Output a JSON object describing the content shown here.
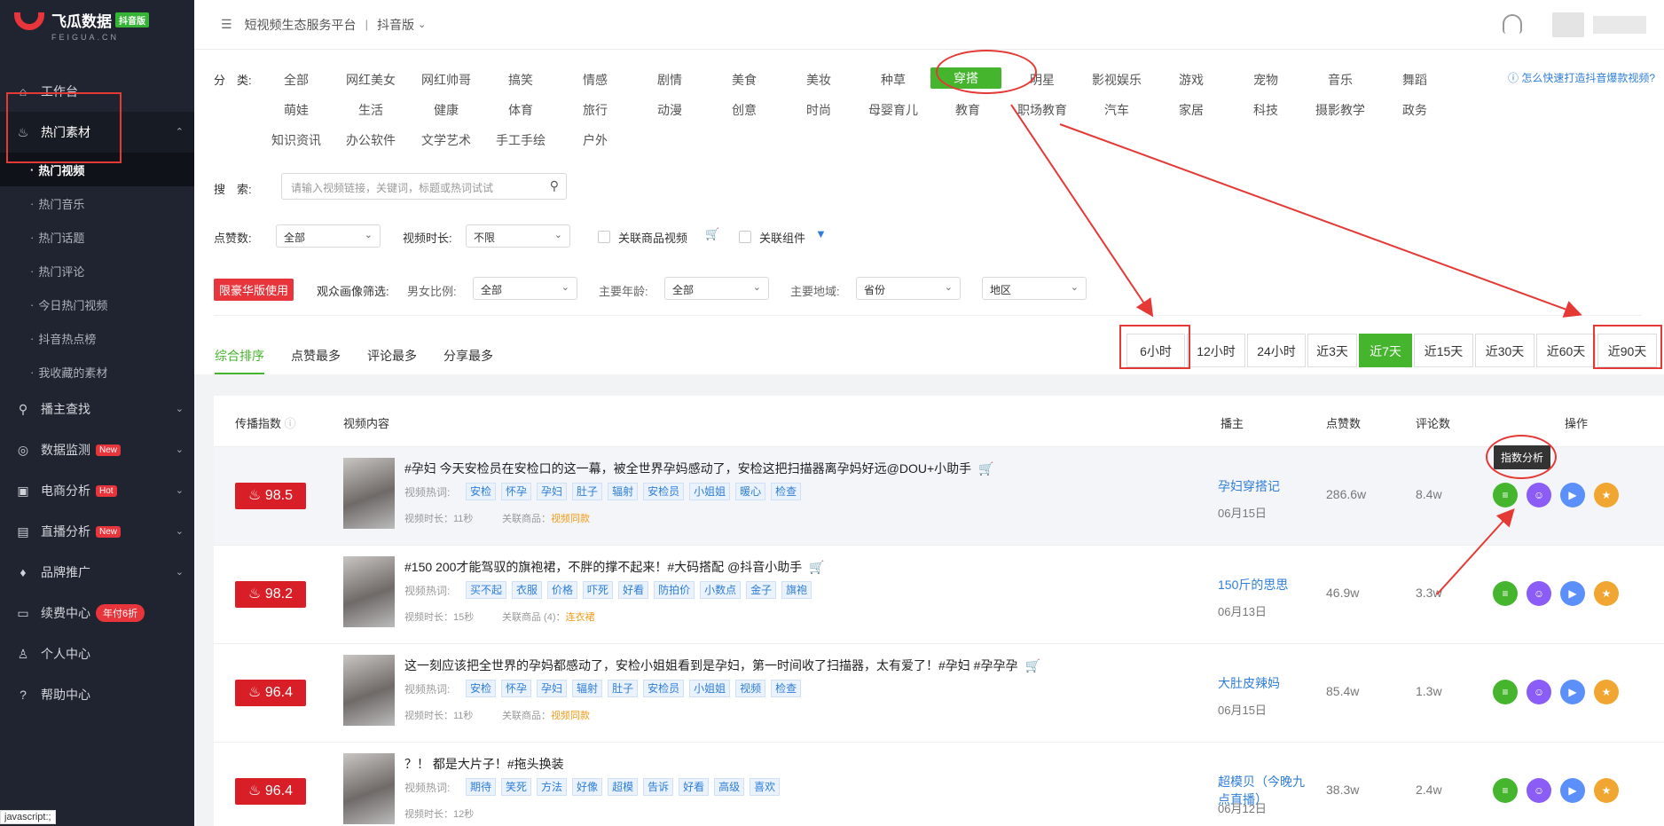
{
  "sidebar": {
    "logo_title": "飞瓜数据",
    "logo_badge": "抖音版",
    "logo_sub": "FEIGUA.CN",
    "workbench": "工作台",
    "hot_material": "热门素材",
    "sub_items": [
      "热门视频",
      "热门音乐",
      "热门话题",
      "热门评论",
      "今日热门视频",
      "抖音热点榜",
      "我收藏的素材"
    ],
    "streamer_search": "播主查找",
    "data_monitor": "数据监测",
    "data_monitor_badge": "New",
    "ecom": "电商分析",
    "ecom_badge": "Hot",
    "live": "直播分析",
    "live_badge": "New",
    "brand": "品牌推广",
    "renew": "续费中心",
    "renew_badge": "年付6折",
    "personal": "个人中心",
    "help": "帮助中心"
  },
  "topbar": {
    "title": "短视频生态服务平台",
    "sep": "|",
    "version": "抖音版"
  },
  "filters": {
    "category_label": "分　类:",
    "categories_row1": [
      "全部",
      "网红美女",
      "网红帅哥",
      "搞笑",
      "情感",
      "剧情",
      "美食",
      "美妆",
      "种草",
      "穿搭",
      "明星",
      "影视娱乐",
      "游戏",
      "宠物",
      "音乐",
      "舞蹈"
    ],
    "categories_row2": [
      "萌娃",
      "生活",
      "健康",
      "体育",
      "旅行",
      "动漫",
      "创意",
      "时尚",
      "母婴育儿",
      "教育",
      "职场教育",
      "汽车",
      "家居",
      "科技",
      "摄影教学",
      "政务"
    ],
    "categories_row3": [
      "知识资讯",
      "办公软件",
      "文学艺术",
      "手工手绘",
      "户外"
    ],
    "help_link": "怎么快速打造抖音爆款视频?",
    "search_label": "搜　索:",
    "search_placeholder": "请输入视频链接，关键词，标题或热词试试",
    "likes_label": "点赞数:",
    "likes_value": "全部",
    "duration_label": "视频时长:",
    "duration_value": "不限",
    "goods_check": "关联商品视频",
    "component_check": "关联组件",
    "lux_badge": "限豪华版使用",
    "audience_label": "观众画像筛选:",
    "gender_label": "男女比例:",
    "gender_value": "全部",
    "age_label": "主要年龄:",
    "age_value": "全部",
    "region_label": "主要地域:",
    "province_value": "省份",
    "area_value": "地区"
  },
  "sort_tabs": [
    "综合排序",
    "点赞最多",
    "评论最多",
    "分享最多"
  ],
  "time_ranges": [
    "6小时",
    "12小时",
    "24小时",
    "近3天",
    "近7天",
    "近15天",
    "近30天",
    "近60天",
    "近90天"
  ],
  "table": {
    "headers": [
      "传播指数",
      "视频内容",
      "播主",
      "点赞数",
      "评论数",
      "操作"
    ],
    "hot_label": "视频热词:",
    "tooltip": "指数分析",
    "rows": [
      {
        "score": "98.5",
        "title": "#孕妇 今天安检员在安检口的这一幕，被全世界孕妈感动了，安检这把扫描器离孕妈好远@DOU+小助手",
        "tags": [
          "安检",
          "怀孕",
          "孕妇",
          "肚子",
          "辐射",
          "安检员",
          "小姐姐",
          "暖心",
          "检查"
        ],
        "duration": "视频时长：11秒",
        "goods_label": "关联商品：",
        "goods_value": "视频同款",
        "author": "孕妇穿搭记",
        "date": "06月15日",
        "likes": "286.6w",
        "comments": "8.4w"
      },
      {
        "score": "98.2",
        "title": "#150 200才能驾驭的旗袍裙，不胖的撑不起来！#大码搭配 @抖音小助手",
        "tags": [
          "买不起",
          "衣服",
          "价格",
          "吓死",
          "好看",
          "防拍价",
          "小数点",
          "金子",
          "旗袍"
        ],
        "duration": "视频时长：15秒",
        "goods_label": "关联商品 (4)：",
        "goods_value": "连衣裙",
        "author": "150斤的思思",
        "date": "06月13日",
        "likes": "46.9w",
        "comments": "3.3w"
      },
      {
        "score": "96.4",
        "title": "这一刻应该把全世界的孕妈都感动了，安检小姐姐看到是孕妇，第一时间收了扫描器，太有爱了！#孕妇 #孕孕孕",
        "tags": [
          "安检",
          "怀孕",
          "孕妇",
          "辐射",
          "肚子",
          "安检员",
          "小姐姐",
          "视频",
          "检查"
        ],
        "duration": "视频时长：11秒",
        "goods_label": "关联商品：",
        "goods_value": "视频同款",
        "author": "大肚皮辣妈",
        "date": "06月15日",
        "likes": "85.4w",
        "comments": "1.3w"
      },
      {
        "score": "96.4",
        "title": "？！ 都是大片子！#拖头换装",
        "tags": [
          "期待",
          "笑死",
          "方法",
          "好像",
          "超模",
          "告诉",
          "好看",
          "高级",
          "喜欢"
        ],
        "duration": "视频时长：12秒",
        "goods_label": "",
        "goods_value": "",
        "author": "超模贝（今晚九点直播）",
        "date": "06月12日",
        "likes": "38.3w",
        "comments": "2.4w"
      }
    ]
  },
  "status_bar": "javascript:;",
  "colors": {
    "accent": "#45b52e",
    "score_red": "#d81e27",
    "link": "#2f7ed8",
    "annotation": "#e53935"
  }
}
